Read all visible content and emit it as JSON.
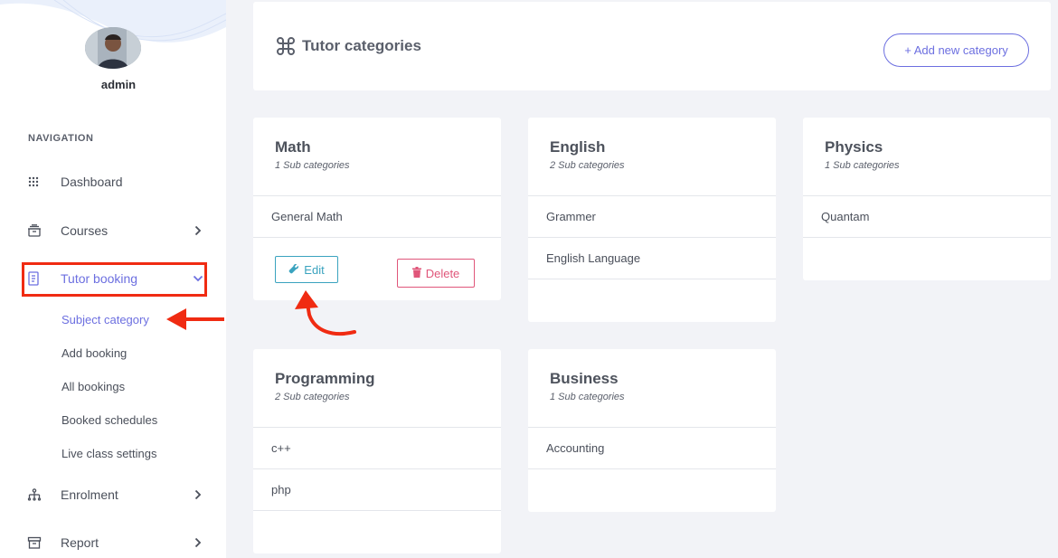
{
  "user": {
    "name": "admin"
  },
  "sidebar": {
    "heading": "NAVIGATION",
    "items": [
      {
        "label": "Dashboard",
        "icon": "grid-dots-icon"
      },
      {
        "label": "Courses",
        "icon": "layers-icon"
      },
      {
        "label": "Tutor booking",
        "icon": "document-icon"
      },
      {
        "label": "Enrolment",
        "icon": "hierarchy-icon"
      },
      {
        "label": "Report",
        "icon": "archive-icon"
      }
    ],
    "subitems": [
      {
        "label": "Subject category",
        "active": true
      },
      {
        "label": "Add booking"
      },
      {
        "label": "All bookings"
      },
      {
        "label": "Booked schedules"
      },
      {
        "label": "Live class settings"
      }
    ]
  },
  "header": {
    "title": "Tutor categories",
    "add_button": "+ Add new category"
  },
  "categories": [
    {
      "name": "Math",
      "count": "1 Sub categories",
      "subs": [
        "General Math"
      ],
      "edit": "Edit",
      "delete": "Delete"
    },
    {
      "name": "English",
      "count": "2 Sub categories",
      "subs": [
        "Grammer",
        "English Language"
      ]
    },
    {
      "name": "Physics",
      "count": "1 Sub categories",
      "subs": [
        "Quantam"
      ]
    },
    {
      "name": "Programming",
      "count": "2 Sub categories",
      "subs": [
        "c++",
        "php"
      ]
    },
    {
      "name": "Business",
      "count": "1 Sub categories",
      "subs": [
        "Accounting"
      ]
    }
  ],
  "colors": {
    "accent": "#6c6fe0",
    "annotation": "#f02b12",
    "edit": "#3aa3bf",
    "delete": "#e0567a"
  }
}
